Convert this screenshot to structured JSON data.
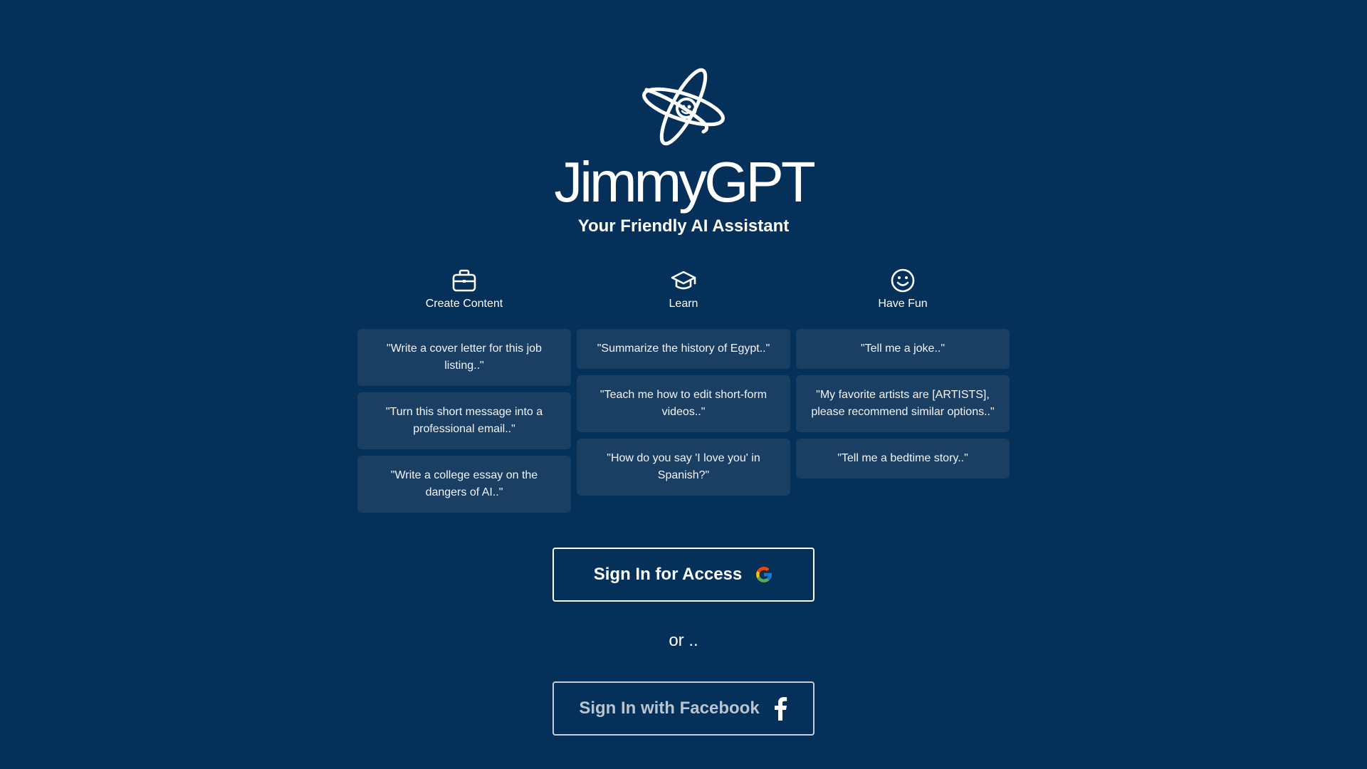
{
  "brand": {
    "name": "JimmyGPT",
    "tagline": "Your Friendly AI Assistant"
  },
  "columns": [
    {
      "title": "Create Content",
      "icon": "briefcase-icon",
      "prompts": [
        "\"Write a cover letter for this job listing..\"",
        "\"Turn this short message into a professional email..\"",
        "\"Write a college essay on the dangers of AI..\""
      ]
    },
    {
      "title": "Learn",
      "icon": "graduation-cap-icon",
      "prompts": [
        "\"Summarize the history of Egypt..\"",
        "\"Teach me how to edit short-form videos..\"",
        "\"How do you say 'I love you' in Spanish?\""
      ]
    },
    {
      "title": "Have Fun",
      "icon": "smiley-icon",
      "prompts": [
        "\"Tell me a joke..\"",
        "\"My favorite artists are [ARTISTS], please recommend similar options..\"",
        "\"Tell me a bedtime story..\""
      ]
    }
  ],
  "auth": {
    "google_label": "Sign In for Access",
    "or_text": "or ..",
    "facebook_label": "Sign In with Facebook"
  },
  "colors": {
    "background": "#04305a",
    "card": "#1b3f63",
    "text": "#ffffff",
    "muted_button_text": "#b9c4cf"
  }
}
